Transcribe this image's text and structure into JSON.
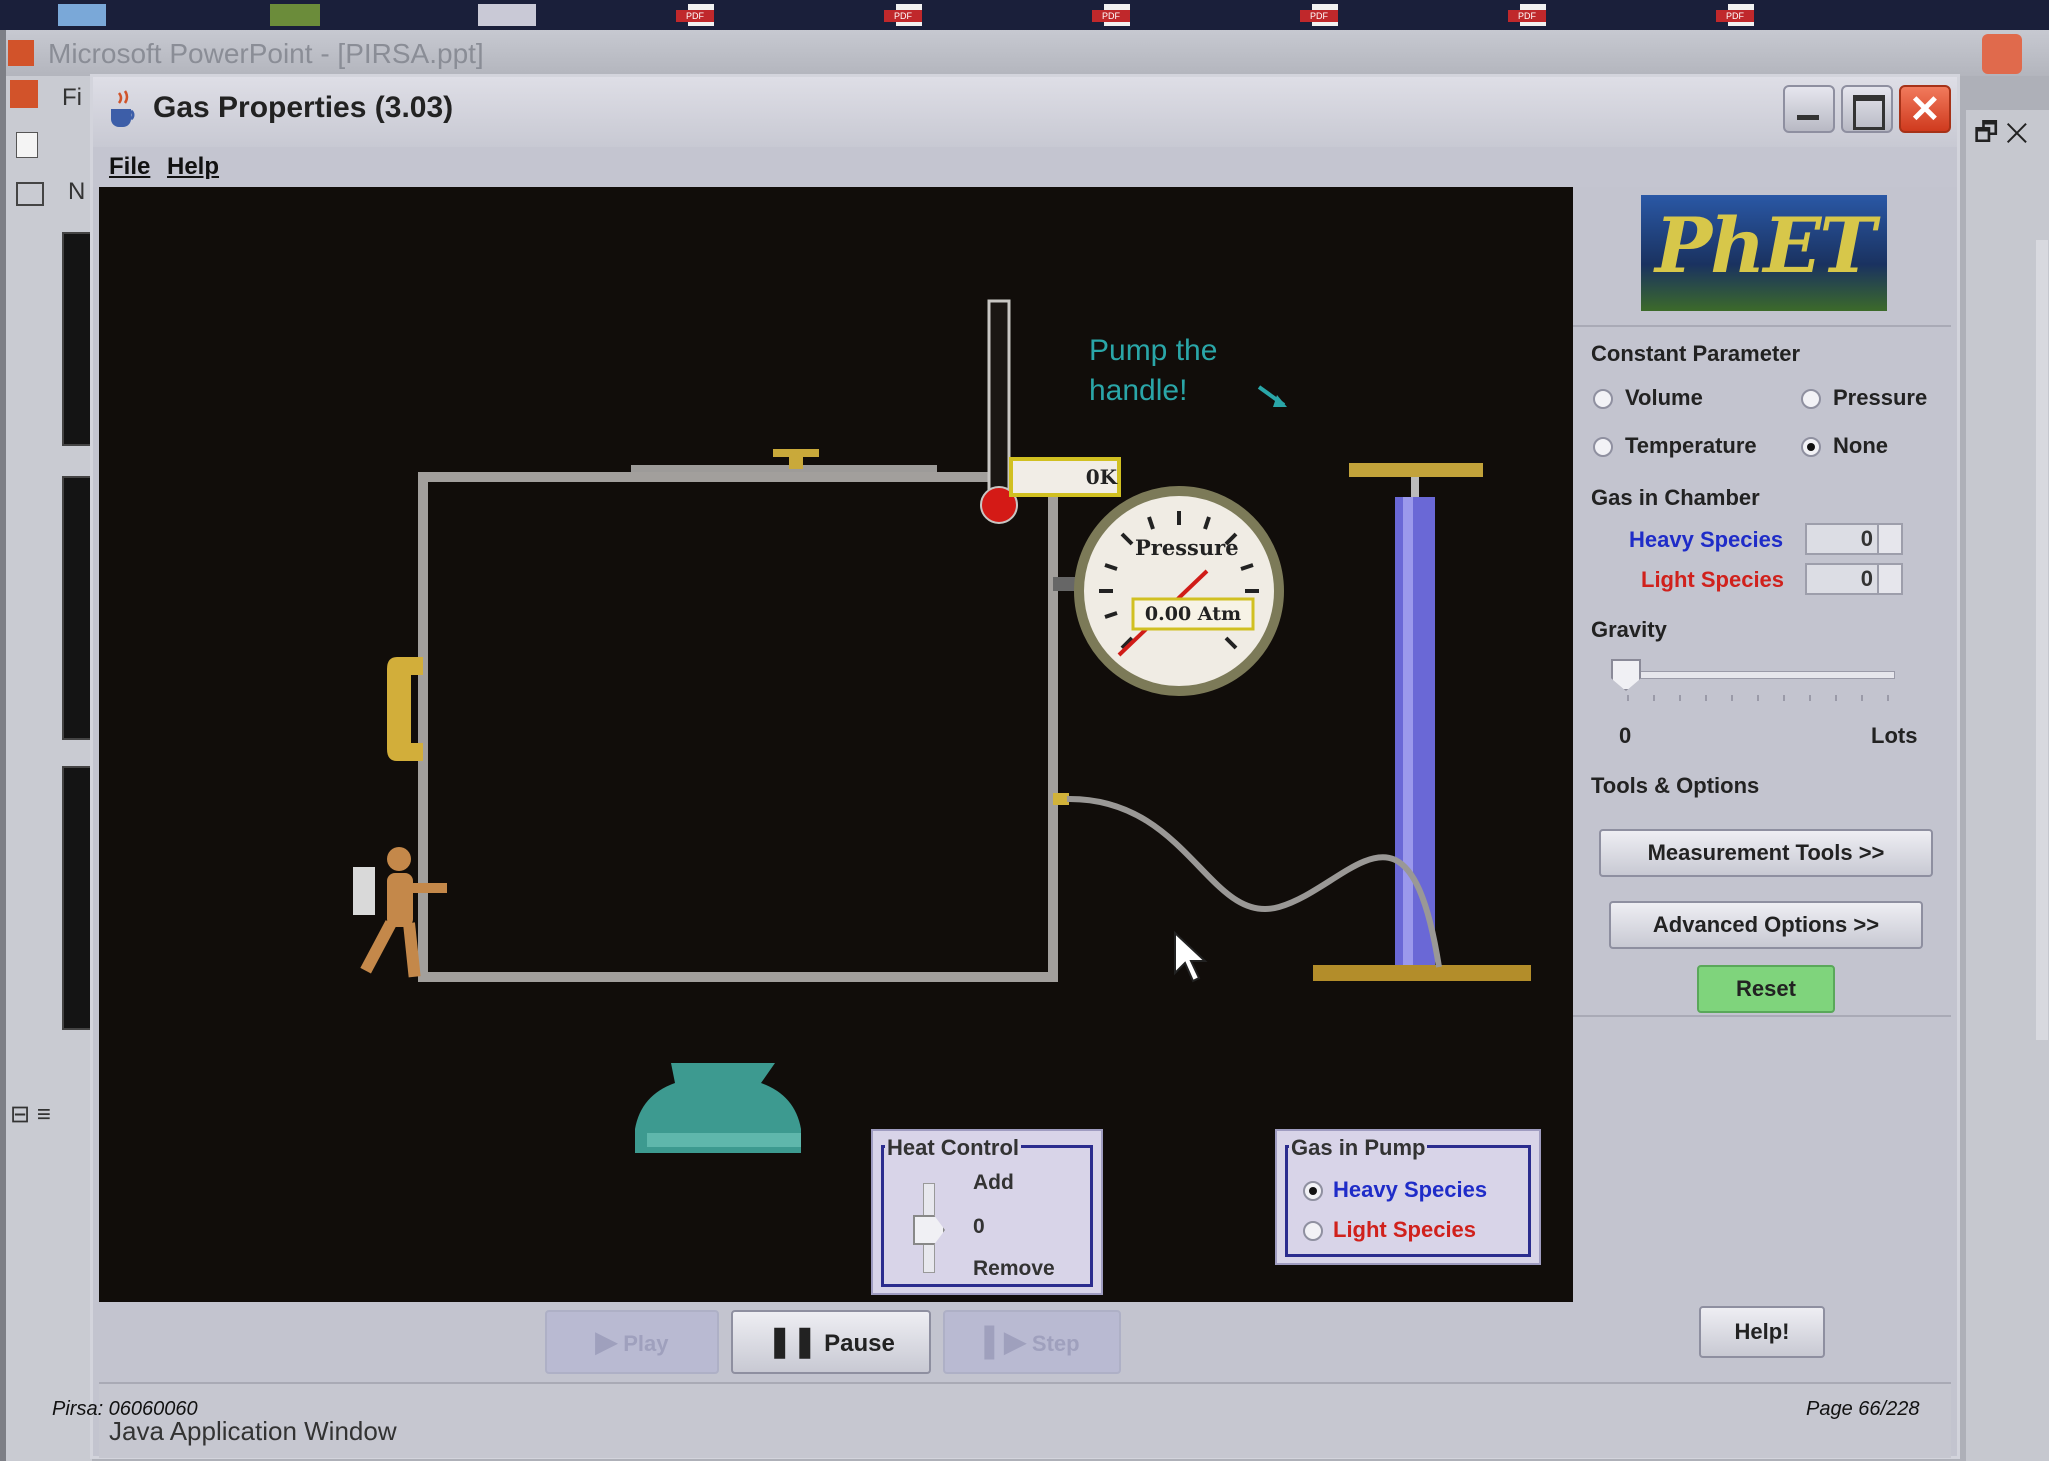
{
  "desktop": {
    "pdf_label": "PDF",
    "pdf_icon_count": 6
  },
  "background_window": {
    "title": "Microsoft PowerPoint - [PIRSA.ppt]",
    "menu_fragment": "Fi",
    "toolbar_fragment": "N"
  },
  "window": {
    "title": "Gas Properties (3.03)",
    "menu": [
      "File",
      "Help"
    ]
  },
  "simulation": {
    "thermometer_readout": "0K",
    "pressure_gauge_label": "Pressure",
    "pressure_readout": "0.00 Atm",
    "hint_text_line1": "Pump the",
    "hint_text_line2": "handle!",
    "heat_control": {
      "title": "Heat Control",
      "add_label": "Add",
      "zero_label": "0",
      "remove_label": "Remove"
    },
    "gas_in_pump": {
      "title": "Gas in Pump",
      "options": [
        "Heavy Species",
        "Light Species"
      ],
      "selected": "Heavy Species"
    }
  },
  "panel": {
    "logo_text": "PhET",
    "constant_parameter": {
      "heading": "Constant Parameter",
      "options": [
        "Volume",
        "Pressure",
        "Temperature",
        "None"
      ],
      "selected": "None"
    },
    "gas_in_chamber": {
      "heading": "Gas in Chamber",
      "heavy_label": "Heavy Species",
      "heavy_value": "0",
      "light_label": "Light Species",
      "light_value": "0"
    },
    "gravity": {
      "heading": "Gravity",
      "min_label": "0",
      "max_label": "Lots",
      "level": 0
    },
    "tools_heading": "Tools & Options",
    "measurement_button": "Measurement Tools >>",
    "advanced_button": "Advanced Options >>",
    "reset_button": "Reset"
  },
  "controls": {
    "play": "Play",
    "pause": "Pause",
    "step": "Step",
    "help": "Help!"
  },
  "statusbar": {
    "text": "Java Application Window"
  },
  "overlay": {
    "source": "Pirsa: 06060060",
    "page": "Page 66/228"
  },
  "colors": {
    "heavy_species": "#1f2cc8",
    "light_species": "#d0211c",
    "hint_text": "#2aa6a8",
    "reset_button": "#7fd47c",
    "canvas_bg": "#110d0a"
  }
}
